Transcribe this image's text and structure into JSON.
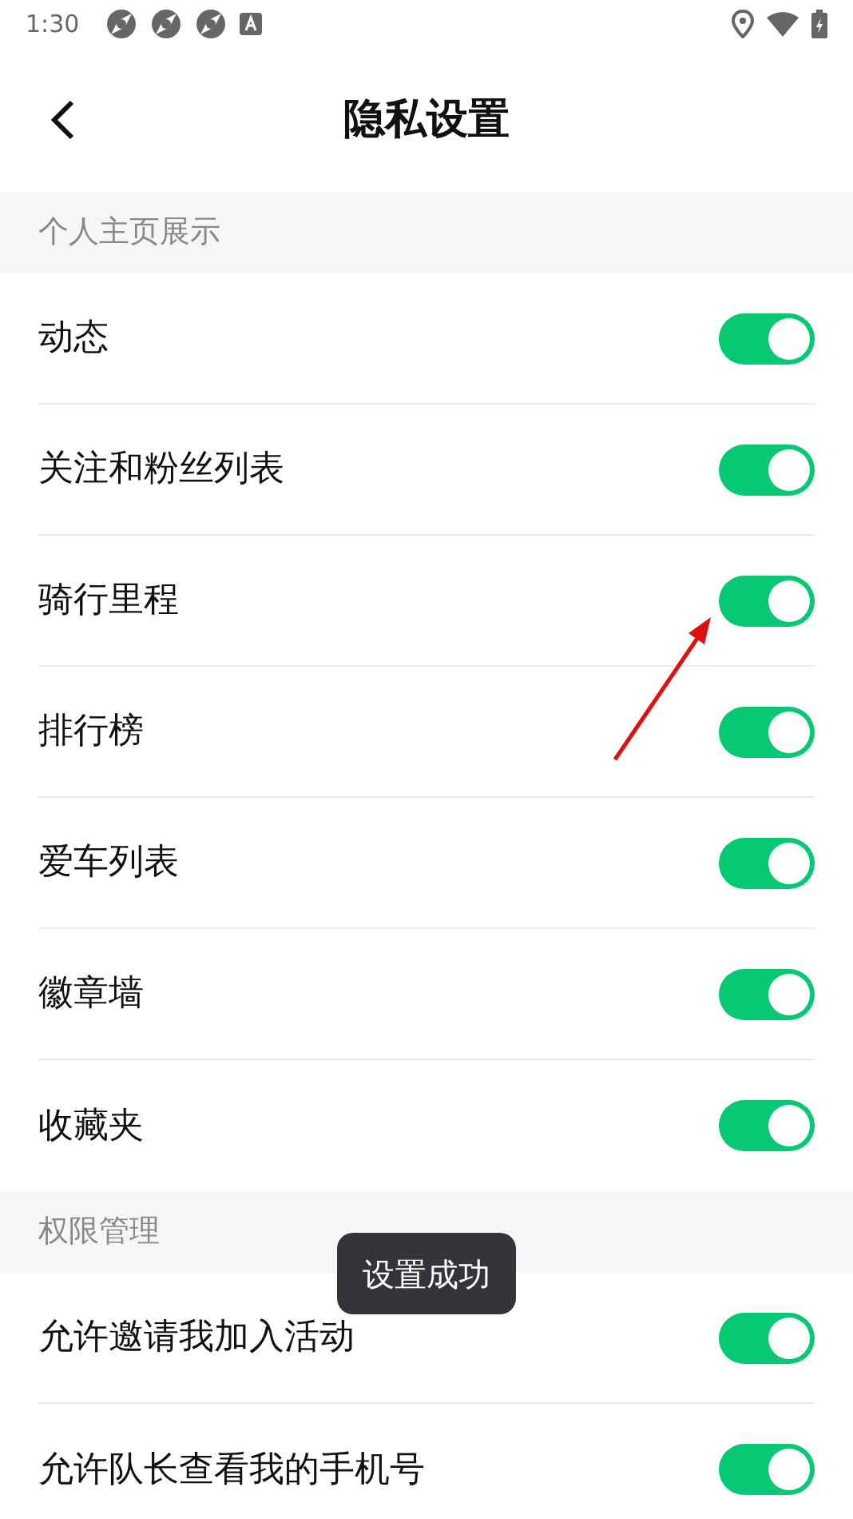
{
  "status_bar": {
    "time": "1:30"
  },
  "header": {
    "title": "隐私设置"
  },
  "sections": [
    {
      "title": "个人主页展示",
      "items": [
        {
          "label": "动态",
          "on": true
        },
        {
          "label": "关注和粉丝列表",
          "on": true
        },
        {
          "label": "骑行里程",
          "on": true
        },
        {
          "label": "排行榜",
          "on": true
        },
        {
          "label": "爱车列表",
          "on": true
        },
        {
          "label": "徽章墙",
          "on": true
        },
        {
          "label": "收藏夹",
          "on": true
        }
      ]
    },
    {
      "title": "权限管理",
      "items": [
        {
          "label": "允许邀请我加入活动",
          "on": true
        },
        {
          "label": "允许队长查看我的手机号",
          "on": true
        }
      ]
    }
  ],
  "toast": {
    "text": "设置成功"
  }
}
